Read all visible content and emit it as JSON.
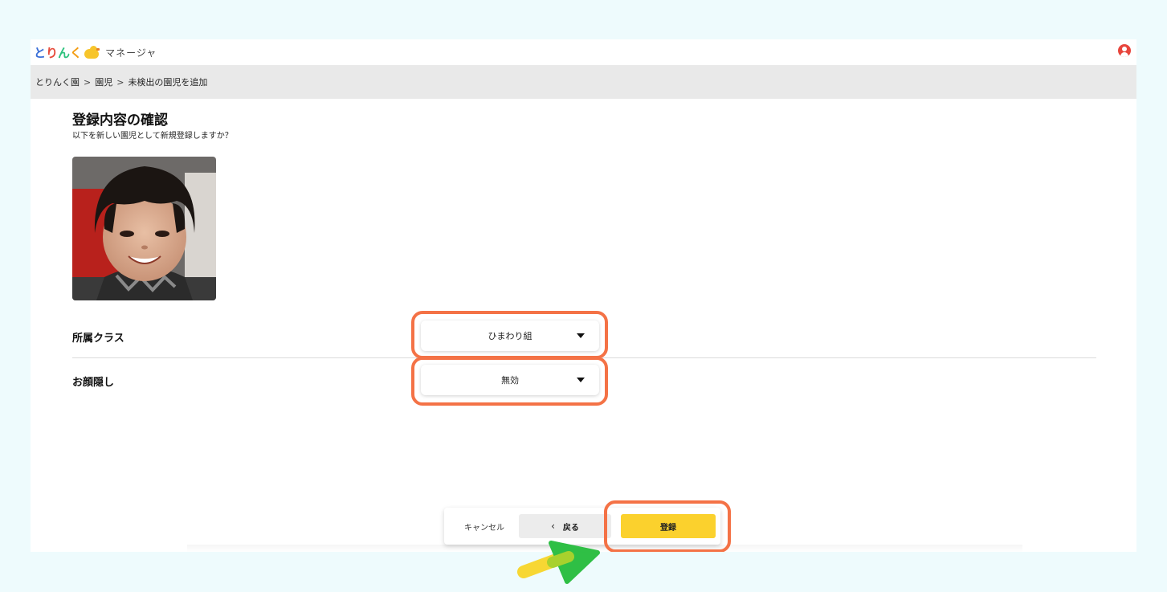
{
  "header": {
    "logo_text": [
      "と",
      "り",
      "ん",
      "く"
    ],
    "app_name": "マネージャ",
    "user_icon": "user-circle-icon"
  },
  "breadcrumb": {
    "items": [
      "とりんく園",
      "園児",
      "未検出の園児を追加"
    ],
    "separator": ">"
  },
  "main": {
    "title": "登録内容の確認",
    "subtitle": "以下を新しい園児として新規登録しますか？",
    "fields": [
      {
        "label": "所属クラス",
        "value": "ひまわり組"
      },
      {
        "label": "お顔隠し",
        "value": "無効"
      }
    ]
  },
  "actions": {
    "cancel_label": "キャンセル",
    "back_label": "戻る",
    "back_icon": "chevron-left-icon",
    "register_label": "登録"
  },
  "colors": {
    "highlight": "#f47246",
    "primary_button": "#fbd12d",
    "background": "#eefbfd"
  }
}
